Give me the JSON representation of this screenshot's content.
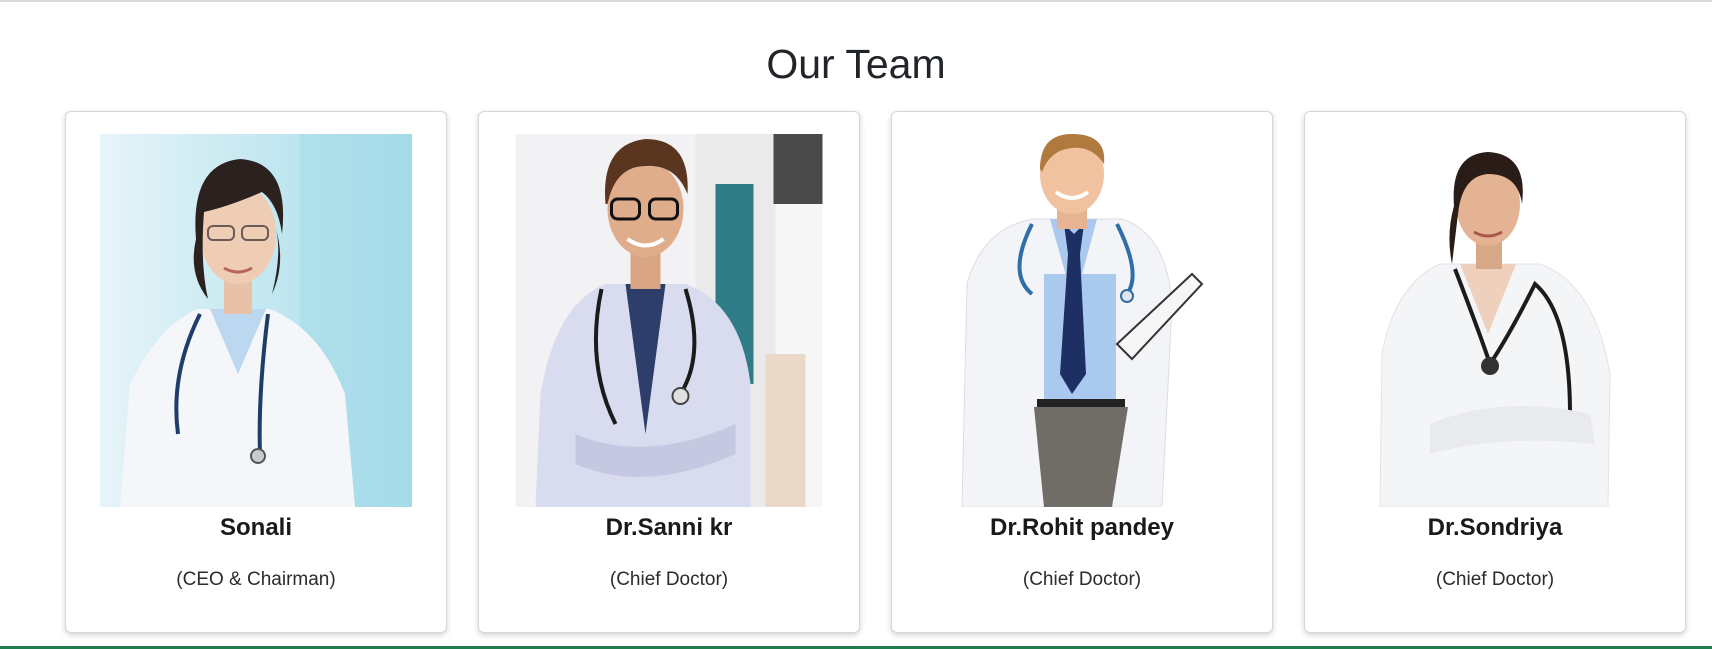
{
  "section": {
    "title": "Our Team"
  },
  "members": [
    {
      "name": "Sonali",
      "role": "(CEO & Chairman)",
      "photo_icon": "female-doctor-photo"
    },
    {
      "name": "Dr.Sanni kr",
      "role": "(Chief Doctor)",
      "photo_icon": "male-doctor-glasses-photo"
    },
    {
      "name": "Dr.Rohit pandey",
      "role": "(Chief Doctor)",
      "photo_icon": "male-doctor-clipboard-photo"
    },
    {
      "name": "Dr.Sondriya",
      "role": "(Chief Doctor)",
      "photo_icon": "female-doctor-stethoscope-photo"
    }
  ],
  "colors": {
    "page_background": "#ffffff",
    "card_border": "#d6d6d6",
    "accent_bottom_rule": "#1f7a4d",
    "text": "#212529"
  }
}
